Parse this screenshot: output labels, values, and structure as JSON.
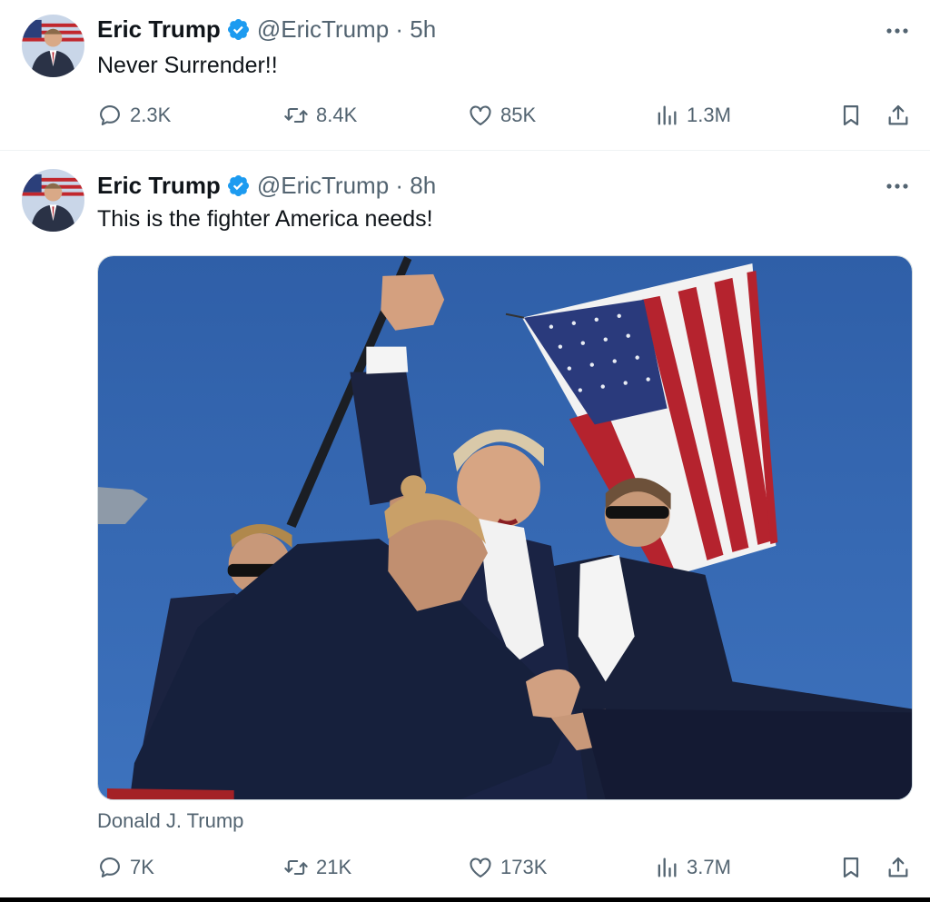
{
  "colors": {
    "verified": "#1d9bf0",
    "secondary_text": "#536471",
    "primary_text": "#0f1419"
  },
  "tweets": [
    {
      "author_name": "Eric Trump",
      "handle": "@EricTrump",
      "time": "5h",
      "text": "Never Surrender!!",
      "stats": {
        "replies": "2.3K",
        "retweets": "8.4K",
        "likes": "85K",
        "views": "1.3M"
      }
    },
    {
      "author_name": "Eric Trump",
      "handle": "@EricTrump",
      "time": "8h",
      "text": "This is the fighter America needs!",
      "media_caption": "Donald J. Trump",
      "stats": {
        "replies": "7K",
        "retweets": "21K",
        "likes": "173K",
        "views": "3.7M"
      }
    }
  ],
  "icons": {
    "verified": "verified-badge-icon",
    "more": "more-options-icon",
    "reply": "reply-icon",
    "retweet": "retweet-icon",
    "like": "heart-icon",
    "views": "views-chart-icon",
    "bookmark": "bookmark-icon",
    "share": "share-icon"
  }
}
